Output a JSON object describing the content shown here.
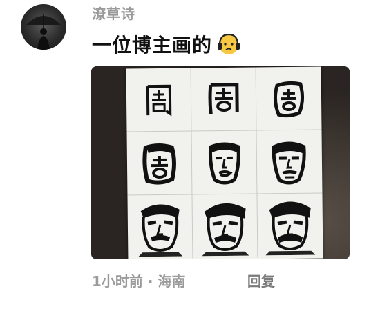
{
  "comment": {
    "username": "潦草诗",
    "text": "一位博主画的",
    "emoji_name": "headphones-face-emoji",
    "time_location": "1小时前 · 海南",
    "reply_label": "回复"
  },
  "photo": {
    "description_icon": "lu-xun-drawing-grid",
    "cells": [
      {
        "name": "character-1"
      },
      {
        "name": "character-2"
      },
      {
        "name": "character-3"
      },
      {
        "name": "face-sketch-1"
      },
      {
        "name": "face-sketch-2"
      },
      {
        "name": "face-sketch-3"
      },
      {
        "name": "portrait-1"
      },
      {
        "name": "portrait-2"
      },
      {
        "name": "portrait-3"
      }
    ]
  }
}
